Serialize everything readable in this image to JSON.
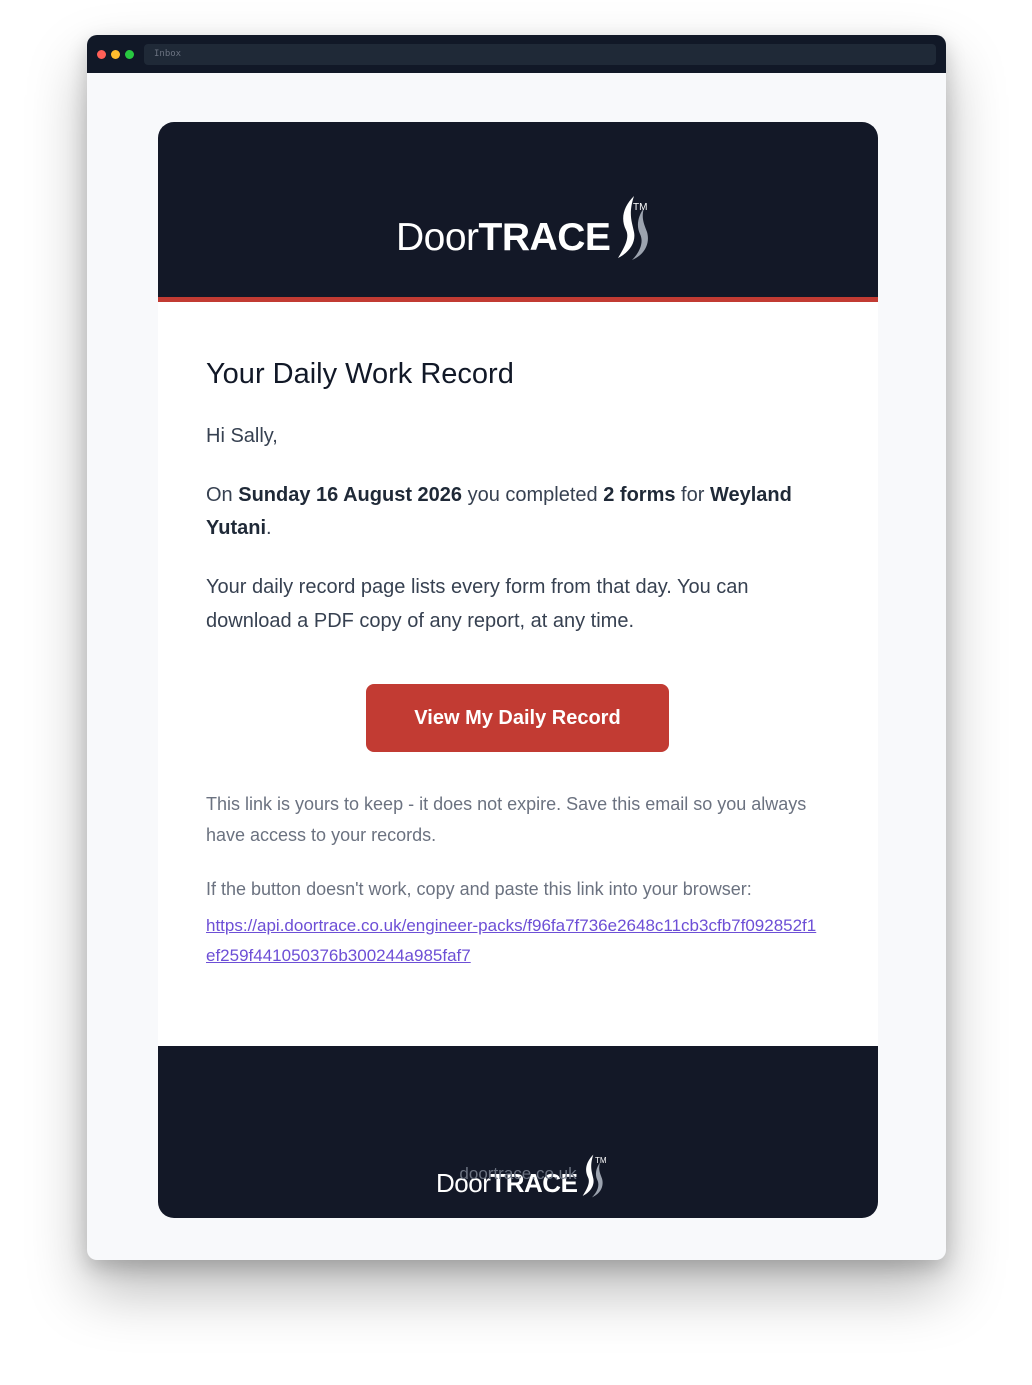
{
  "window": {
    "address": "Inbox"
  },
  "email": {
    "brand": {
      "name_light": "Door",
      "name_bold": "TRACE",
      "trademark": "TM",
      "icon": "flame-icon"
    },
    "heading": "Your Daily Work Record",
    "greeting": "Hi Sally,",
    "summary": {
      "prefix": "On ",
      "date": "Sunday 16 August 2026",
      "middle": " you completed ",
      "forms": "2 forms",
      "for": " for ",
      "company": "Weyland Yutani",
      "suffix": "."
    },
    "info": "Your daily record page lists every form from that day. You can download a PDF copy of any report, at any time.",
    "cta_label": "View My Daily Record",
    "expire_note": "This link is yours to keep - it does not expire. Save this email so you always have access to your records.",
    "fallback_note": "If the button doesn't work, copy and paste this link into your browser:",
    "fallback_link": "https://api.doortrace.co.uk/engineer-packs/f96fa7f736e2648c11cb3cfb7f092852f1ef259f441050376b300244a985faf7",
    "footer": {
      "site": "doortrace.co.uk"
    }
  },
  "colors": {
    "header_bg": "#131827",
    "accent_red": "#c23b33",
    "link": "#6d4fd6"
  }
}
